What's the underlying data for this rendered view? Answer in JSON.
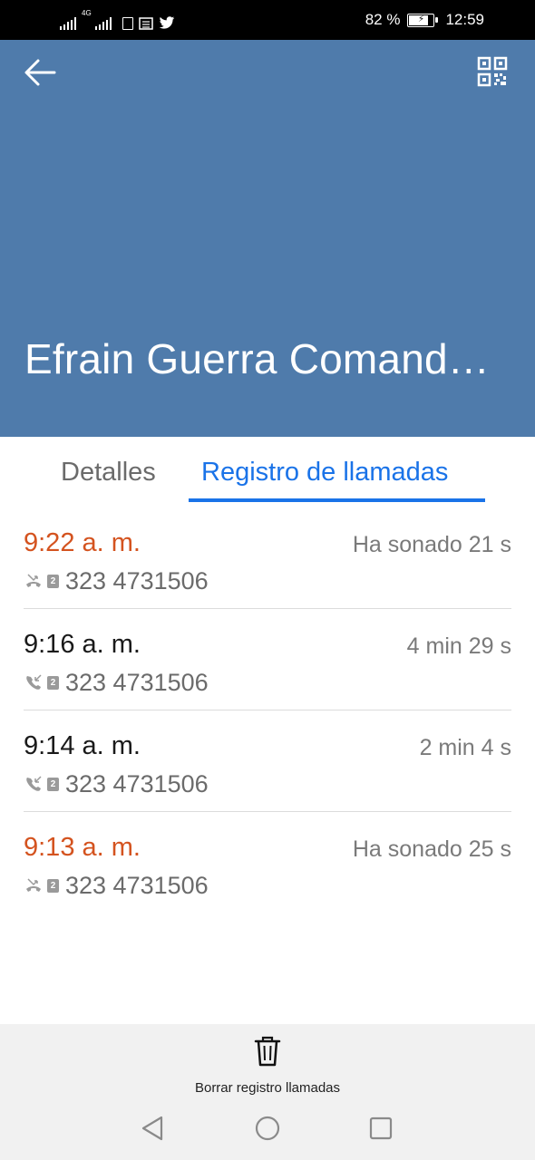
{
  "status_bar": {
    "network_label": "4G",
    "battery_text": "82 %",
    "battery_level": 0.82,
    "time": "12:59",
    "icons": [
      "signal-icon",
      "signal-4g-icon",
      "sim-icon",
      "news-icon",
      "twitter-icon",
      "battery-charging-icon"
    ]
  },
  "header": {
    "background_color": "#4f7bab",
    "back_icon": "arrow-back-icon",
    "qr_icon": "qr-code-icon",
    "contact_name": "Efrain Guerra Comand…"
  },
  "tabs": [
    {
      "label": "Detalles",
      "active": false
    },
    {
      "label": "Registro de llamadas",
      "active": true
    }
  ],
  "accent_color": "#1a73e8",
  "missed_color": "#d4531f",
  "calls": [
    {
      "time": "9:22 a. m.",
      "type": "missed",
      "sim": "2",
      "number": "323 4731506",
      "duration": "Ha sonado 21 s"
    },
    {
      "time": "9:16 a. m.",
      "type": "incoming",
      "sim": "2",
      "number": "323 4731506",
      "duration": "4 min 29 s"
    },
    {
      "time": "9:14 a. m.",
      "type": "incoming",
      "sim": "2",
      "number": "323 4731506",
      "duration": "2 min 4 s"
    },
    {
      "time": "9:13 a. m.",
      "type": "missed",
      "sim": "2",
      "number": "323 4731506",
      "duration": "Ha sonado 25 s"
    }
  ],
  "bottom_action": {
    "icon": "trash-icon",
    "label": "Borrar registro llamadas"
  },
  "nav_bar": {
    "icons": [
      "nav-back-icon",
      "nav-home-icon",
      "nav-recents-icon"
    ]
  }
}
